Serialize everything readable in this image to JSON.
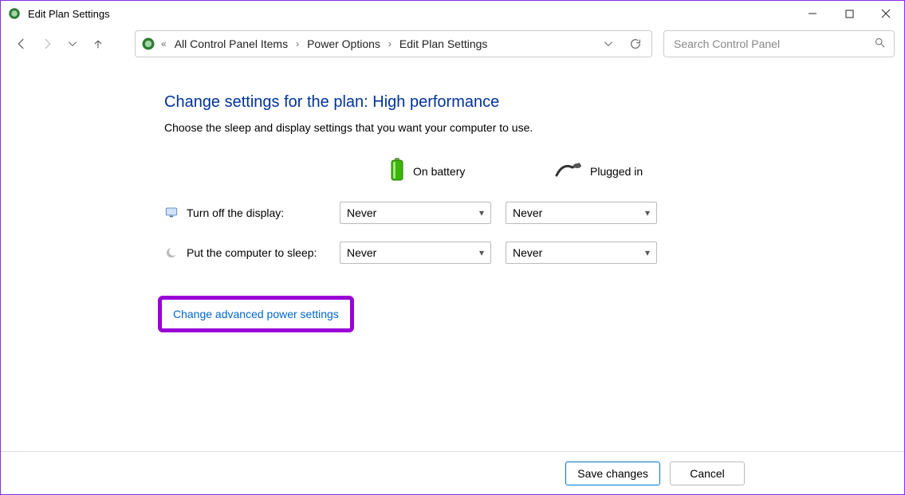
{
  "titlebar": {
    "title": "Edit Plan Settings"
  },
  "breadcrumb": {
    "items": [
      "All Control Panel Items",
      "Power Options",
      "Edit Plan Settings"
    ]
  },
  "search": {
    "placeholder": "Search Control Panel"
  },
  "heading": "Change settings for the plan: High performance",
  "subtext": "Choose the sleep and display settings that you want your computer to use.",
  "columns": {
    "battery": "On battery",
    "plugged": "Plugged in"
  },
  "rows": {
    "display": {
      "label": "Turn off the display:",
      "battery": "Never",
      "plugged": "Never"
    },
    "sleep": {
      "label": "Put the computer to sleep:",
      "battery": "Never",
      "plugged": "Never"
    }
  },
  "links": {
    "advanced": "Change advanced power settings"
  },
  "buttons": {
    "save": "Save changes",
    "cancel": "Cancel"
  }
}
